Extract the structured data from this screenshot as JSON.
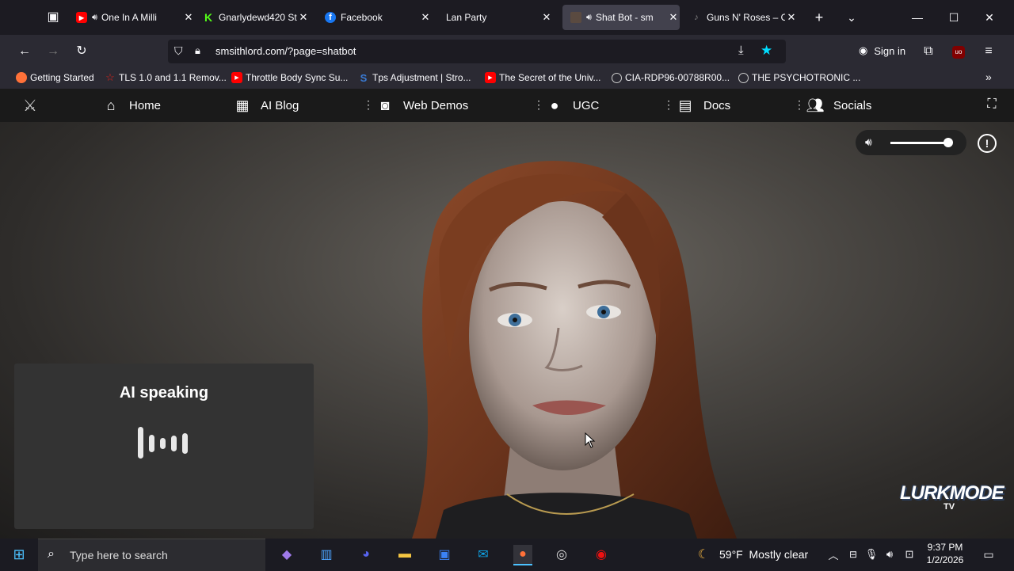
{
  "browser": {
    "tabs": [
      {
        "title": "One In A Milli",
        "favicon": "youtube-icon",
        "audio": true,
        "active": false
      },
      {
        "title": "Gnarlydewd420 St",
        "favicon": "kick-icon",
        "audio": false,
        "active": false
      },
      {
        "title": "Facebook",
        "favicon": "facebook-icon",
        "audio": false,
        "active": false
      },
      {
        "title": "Lan Party",
        "favicon": "",
        "audio": false,
        "active": false
      },
      {
        "title": "Shat Bot - sm",
        "favicon": "page-icon",
        "audio": true,
        "active": true
      },
      {
        "title": "Guns N' Roses – O",
        "favicon": "music-icon",
        "audio": false,
        "active": false
      }
    ],
    "url": "smsithlord.com/?page=shatbot",
    "sign_in_label": "Sign in",
    "bookmarks": [
      {
        "label": "Getting Started",
        "icon": "firefox-icon",
        "color": "#ff7139"
      },
      {
        "label": "TLS 1.0 and 1.1 Remov...",
        "icon": "star-icon",
        "color": "#e2231a"
      },
      {
        "label": "Throttle Body Sync Su...",
        "icon": "youtube-icon",
        "color": "#ff0000"
      },
      {
        "label": "Tps Adjustment | Stro...",
        "icon": "s-icon",
        "color": "#3a7bd5"
      },
      {
        "label": "The Secret of the Univ...",
        "icon": "youtube-icon",
        "color": "#ff0000"
      },
      {
        "label": "CIA-RDP96-00788R00...",
        "icon": "globe-icon",
        "color": "#cccccc"
      },
      {
        "label": "THE PSYCHOTRONIC ...",
        "icon": "globe-icon",
        "color": "#cccccc"
      }
    ]
  },
  "site_nav": {
    "items": [
      {
        "label": "Home",
        "icon": "home-icon"
      },
      {
        "label": "AI Blog",
        "icon": "calendar-icon"
      },
      {
        "label": "Web Demos",
        "icon": "camera-icon"
      },
      {
        "label": "UGC",
        "icon": "user-secret-icon"
      },
      {
        "label": "Docs",
        "icon": "document-icon"
      },
      {
        "label": "Socials",
        "icon": "users-icon"
      }
    ]
  },
  "stage": {
    "speaking_label": "AI speaking",
    "volume_level": 0.93,
    "watermark": "LURKMODE TV"
  },
  "taskbar": {
    "search_placeholder": "Type here to search",
    "weather": "59°F  Mostly clear",
    "time": "9:37 PM",
    "date": "1/2/2026"
  }
}
